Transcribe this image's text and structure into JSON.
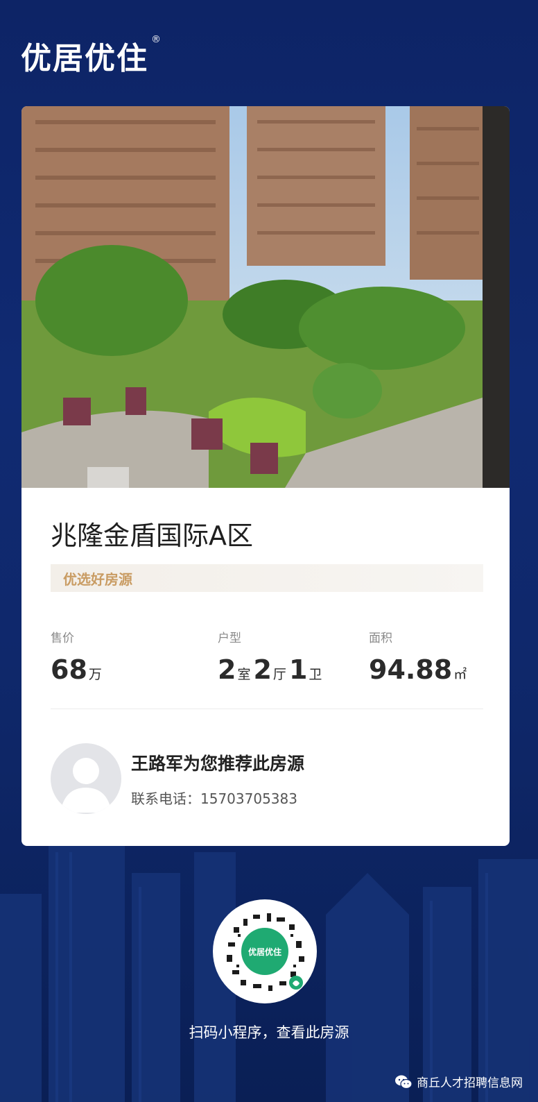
{
  "brand": {
    "name": "优居优住",
    "registered_mark": "®"
  },
  "listing": {
    "title": "兆隆金盾国际A区",
    "tag": "优选好房源",
    "stats": {
      "price": {
        "label": "售价",
        "value": "68",
        "unit": "万"
      },
      "layout": {
        "label": "户型",
        "rooms": "2",
        "rooms_unit": "室",
        "halls": "2",
        "halls_unit": "厅",
        "baths": "1",
        "baths_unit": "卫"
      },
      "area": {
        "label": "面积",
        "value": "94.88",
        "unit": "㎡"
      }
    }
  },
  "agent": {
    "name": "王路军",
    "recommend_text": "为您推荐此房源",
    "phone_label": "联系电话：",
    "phone": "15703705383"
  },
  "qr": {
    "center_logo": "优居优住",
    "caption": "扫码小程序，查看此房源"
  },
  "watermark": {
    "text": "商丘人才招聘信息网"
  },
  "colors": {
    "background": "#0d2466",
    "price": "#e03131",
    "tag_text": "#c99c63",
    "qr_accent": "#1faa72"
  }
}
